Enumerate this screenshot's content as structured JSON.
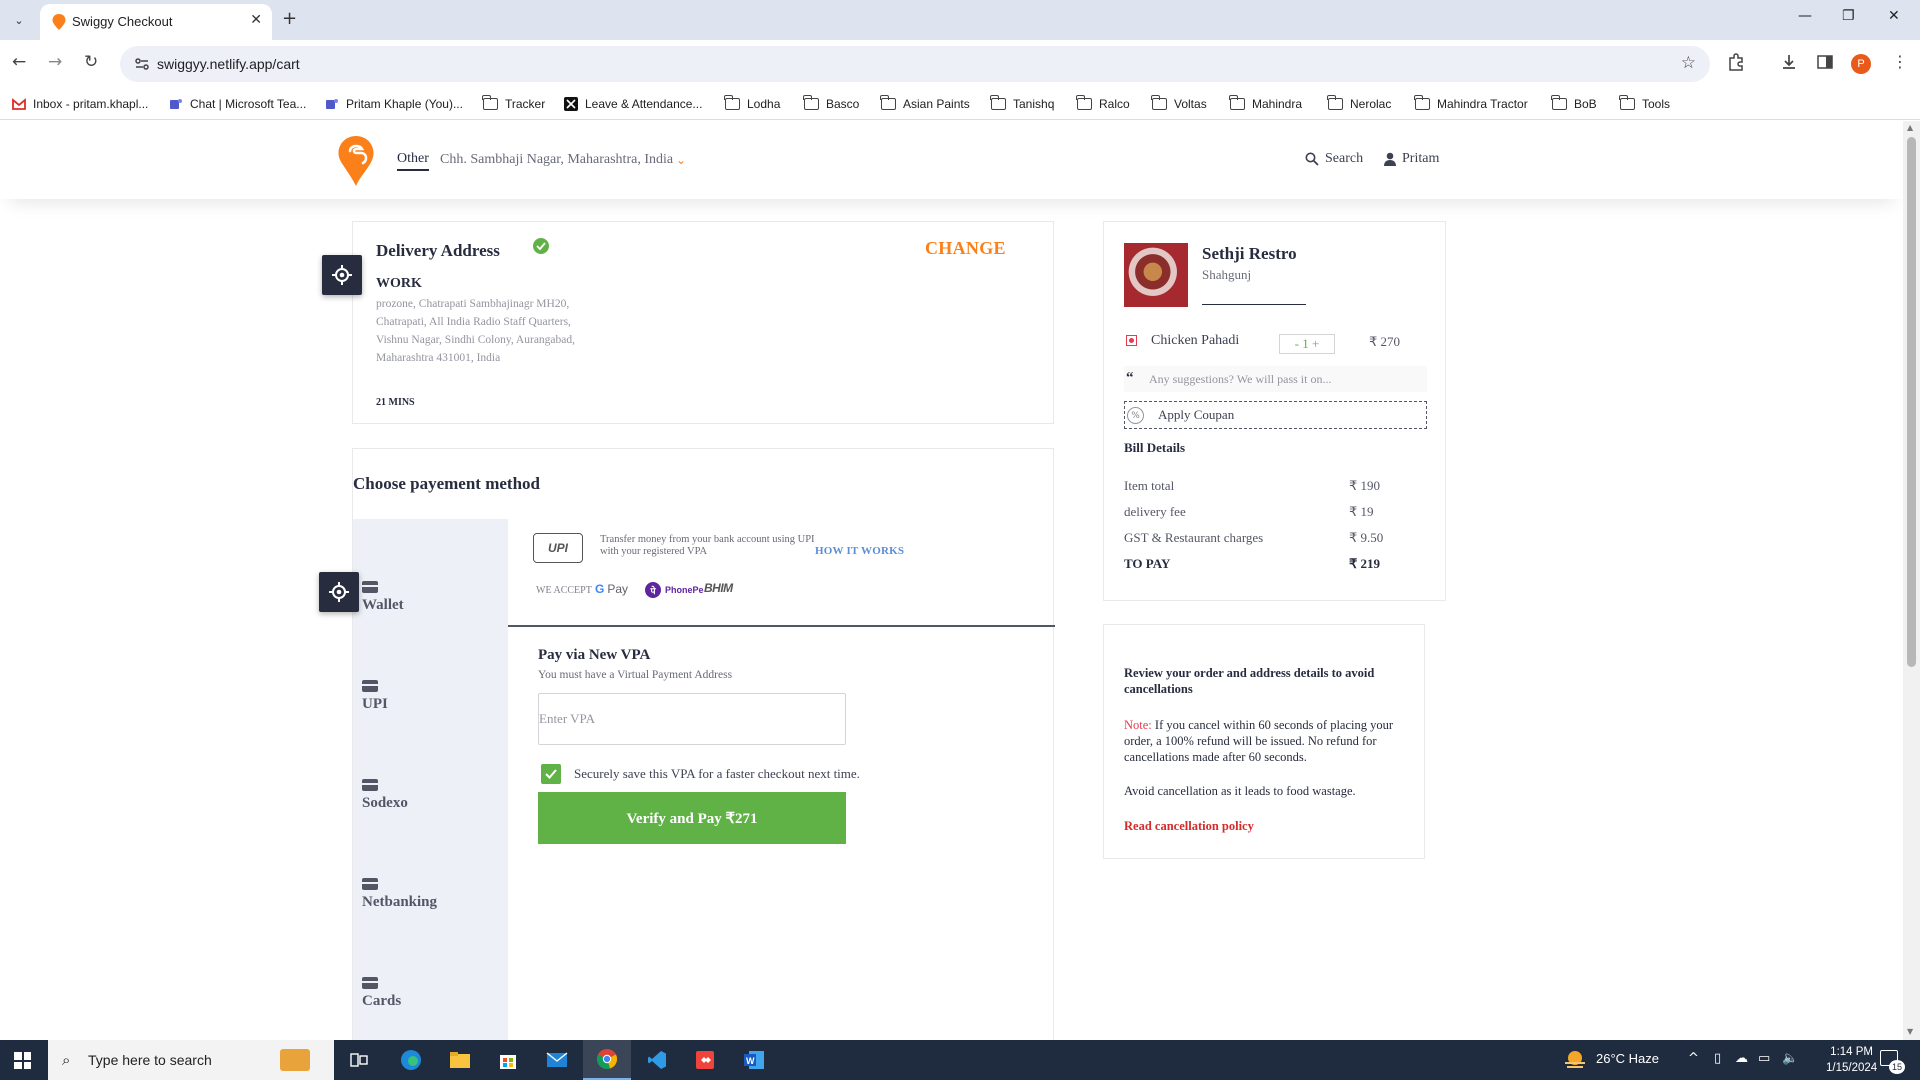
{
  "browser": {
    "tab_title": "Swiggy Checkout",
    "url": "swiggyy.netlify.app/cart",
    "profile_initial": "P",
    "bookmarks": [
      {
        "label": "Inbox - pritam.khapl...",
        "icon": "gmail-icon"
      },
      {
        "label": "Chat | Microsoft Tea...",
        "icon": "teams-icon"
      },
      {
        "label": "Pritam Khaple (You)...",
        "icon": "teams-icon"
      },
      {
        "label": "Tracker",
        "icon": "folder-icon"
      },
      {
        "label": "Leave & Attendance...",
        "icon": "x-icon"
      },
      {
        "label": "Lodha",
        "icon": "folder-icon"
      },
      {
        "label": "Basco",
        "icon": "folder-icon"
      },
      {
        "label": "Asian Paints",
        "icon": "folder-icon"
      },
      {
        "label": "Tanishq",
        "icon": "folder-icon"
      },
      {
        "label": "Ralco",
        "icon": "folder-icon"
      },
      {
        "label": "Voltas",
        "icon": "folder-icon"
      },
      {
        "label": "Mahindra",
        "icon": "folder-icon"
      },
      {
        "label": "Nerolac",
        "icon": "folder-icon"
      },
      {
        "label": "Mahindra Tractor",
        "icon": "folder-icon"
      },
      {
        "label": "BoB",
        "icon": "folder-icon"
      },
      {
        "label": "Tools",
        "icon": "folder-icon"
      }
    ]
  },
  "header": {
    "address_type": "Other",
    "address_text": "Chh. Sambhaji Nagar, Maharashtra, India",
    "search_label": "Search",
    "user_name": "Pritam",
    "brand_color": "#fc8019"
  },
  "delivery": {
    "title": "Delivery Address",
    "change_label": "CHANGE",
    "label": "WORK",
    "address": "prozone, Chatrapati Sambhajinagr MH20, Chatrapati, All India Radio Staff Quarters, Vishnu Nagar, Sindhi Colony, Aurangabad, Maharashtra 431001, India",
    "eta": "21 MINS"
  },
  "payment": {
    "title": "Choose payement method",
    "methods": [
      "Wallet",
      "UPI",
      "Sodexo",
      "Netbanking",
      "Cards"
    ],
    "upi_logo": "UPI",
    "upi_description": "Transfer money from your bank account using UPI with your registered VPA",
    "how_it_works": "HOW IT WORKS",
    "we_accept": "WE ACCEPT",
    "accepted": [
      "G Pay",
      "PhonePe",
      "BHIM"
    ],
    "vpa_title": "Pay via New VPA",
    "vpa_subtitle": "You must have a Virtual Payment Address",
    "vpa_placeholder": "Enter VPA",
    "save_vpa_label": "Securely save this VPA for a faster checkout next time.",
    "save_vpa_checked": true,
    "verify_button": "Verify and Pay ₹271",
    "accent": "#60b246"
  },
  "cart": {
    "restaurant": "Sethji Restro",
    "area": "Shahgunj",
    "items": [
      {
        "name": "Chicken Pahadi",
        "qty": "- 1 +",
        "price": "₹ 270"
      }
    ],
    "suggestion_placeholder": "Any suggestions? We will pass it on...",
    "coupon_label": "Apply Coupan",
    "bill_title": "Bill Details",
    "bill": [
      {
        "label": "Item total",
        "value": "₹ 190"
      },
      {
        "label": "delivery fee",
        "value": "₹ 19"
      },
      {
        "label": "GST & Restaurant charges",
        "value": "₹ 9.50"
      },
      {
        "label": "TO PAY",
        "value": "₹ 219"
      }
    ]
  },
  "note": {
    "heading": "Review your order and address details to avoid cancellations",
    "note_prefix": "Note:",
    "note_text": " If you cancel within 60 seconds of placing your order, a 100% refund will be issued. No refund for cancellations made after 60 seconds.",
    "avoid": "Avoid cancellation as it leads to food wastage.",
    "policy_link": "Read cancellation policy"
  },
  "taskbar": {
    "search_placeholder": "Type here to search",
    "weather": "26°C  Haze",
    "time": "1:14 PM",
    "date": "1/15/2024",
    "notification_count": "15"
  }
}
